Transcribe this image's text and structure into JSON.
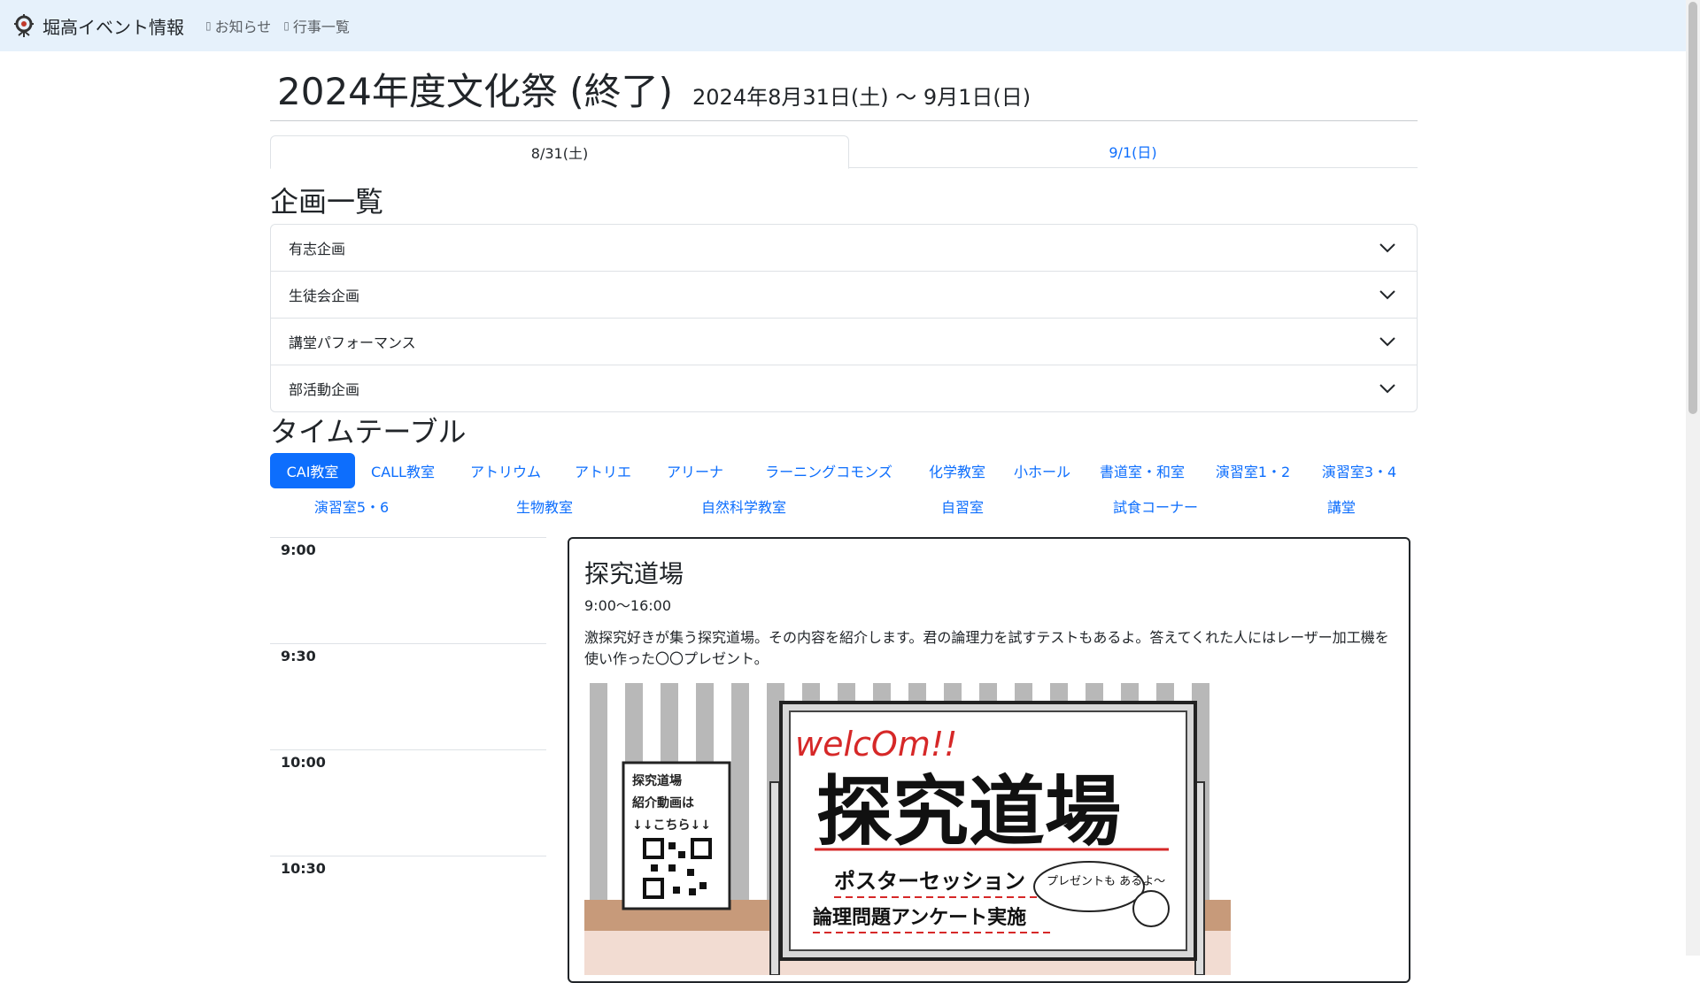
{
  "navbar": {
    "brand": "堀高イベント情報",
    "links": [
      {
        "icon": "megaphone-icon",
        "label": "お知らせ"
      },
      {
        "icon": "calendar-icon",
        "label": "行事一覧"
      }
    ]
  },
  "header": {
    "title": "2024年度文化祭 (終了)",
    "dates": "2024年8月31日(土) ～ 9月1日(日)"
  },
  "tabs": [
    {
      "label": "8/31(土)",
      "active": true
    },
    {
      "label": "9/1(日)",
      "active": false
    }
  ],
  "projects": {
    "heading": "企画一覧",
    "items": [
      "有志企画",
      "生徒会企画",
      "講堂パフォーマンス",
      "部活動企画"
    ]
  },
  "timetable": {
    "heading": "タイムテーブル",
    "rooms_row1": [
      "CAI教室",
      "CALL教室",
      "アトリウム",
      "アトリエ",
      "アリーナ",
      "ラーニングコモンズ",
      "化学教室",
      "小ホール",
      "書道室・和室",
      "演習室1・2",
      "演習室3・4"
    ],
    "rooms_row2": [
      "演習室5・6",
      "生物教室",
      "自然科学教室",
      "自習室",
      "試食コーナー",
      "講堂"
    ],
    "active_room": "CAI教室",
    "times": [
      "9:00",
      "9:30",
      "10:00",
      "10:30"
    ]
  },
  "event": {
    "title": "探究道場",
    "time": "9:00～16:00",
    "description": "激探究好きが集う探究道場。その内容を紹介します。君の論理力を試すテストもあるよ。答えてくれた人にはレーザー加工機を使い作った〇〇プレゼント。",
    "poster": {
      "welcome": "welcOm!!",
      "board_title": "探究道場",
      "line1": "ポスターセッション",
      "line2": "論理問題アンケート実施",
      "bubble": "プレゼントも あるよ～",
      "sign_line1": "探究道場",
      "sign_line2": "紹介動画は",
      "sign_line3": "↓↓こちら↓↓"
    }
  },
  "colors": {
    "navbar_bg": "#e6f1fb",
    "accent": "#0d6efd",
    "text": "#212529"
  }
}
